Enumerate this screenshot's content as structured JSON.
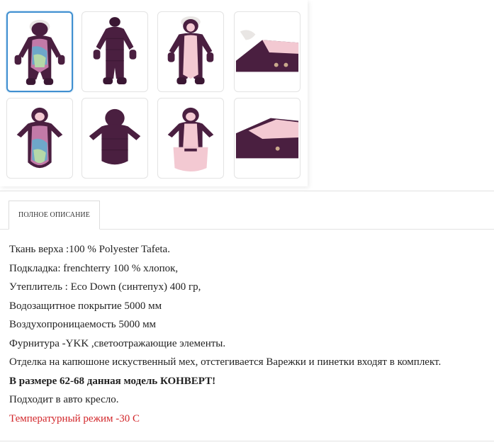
{
  "gallery": {
    "thumbnails": [
      {
        "name": "thumb-front-print",
        "active": true
      },
      {
        "name": "thumb-front-solid",
        "active": false
      },
      {
        "name": "thumb-open-pink",
        "active": false
      },
      {
        "name": "thumb-hood-detail",
        "active": false
      },
      {
        "name": "thumb-envelope-print",
        "active": false
      },
      {
        "name": "thumb-back-envelope",
        "active": false
      },
      {
        "name": "thumb-envelope-open",
        "active": false
      },
      {
        "name": "thumb-cuff-detail",
        "active": false
      }
    ],
    "colors": {
      "plum": "#4a1f40",
      "pink": "#f3c9d2",
      "active_border": "#3f8fd0"
    }
  },
  "tabs": {
    "full_description": "ПОЛНОЕ ОПИСАНИЕ"
  },
  "description": {
    "lines": [
      "Ткань верха :100 % Polyester Tafeta.",
      "Подкладка: frenchterry 100 % хлопок,",
      "Утеплитель : Eco Down (синтепух) 400 гр,",
      "Водозащитное покрытие 5000 мм",
      "Воздухопроницаемость 5000 мм",
      "Фурнитура -YKK ,светоотражающие элементы.",
      "Отделка на капюшоне искуственный мех, отстегивается Варежки и пинетки входят в комплект.",
      "В размере 62-68 данная модель КОНВЕРТ!",
      "Подходит в авто кресло.",
      "Температурный режим -30 С"
    ],
    "highlight_color": "#d2262a"
  }
}
